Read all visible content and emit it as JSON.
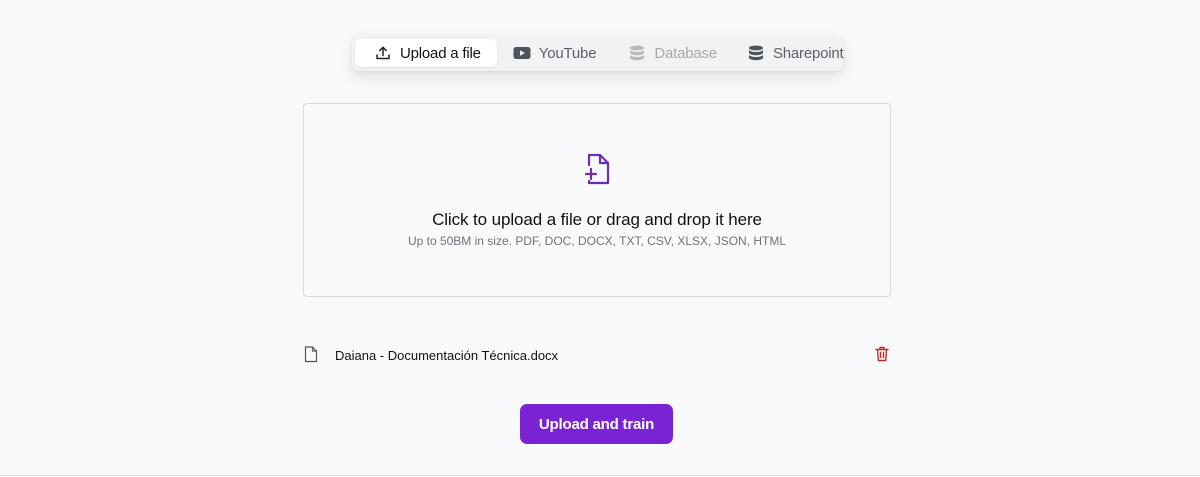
{
  "tabs": [
    {
      "label": "Upload a file",
      "icon": "upload-icon",
      "state": "active"
    },
    {
      "label": "YouTube",
      "icon": "youtube-icon",
      "state": "normal"
    },
    {
      "label": "Database",
      "icon": "database-icon",
      "state": "disabled"
    },
    {
      "label": "Sharepoint",
      "icon": "database-icon",
      "state": "normal"
    }
  ],
  "dropzone": {
    "icon": "file-plus-icon",
    "title": "Click to upload a file or drag and drop it here",
    "subtitle": "Up to 50BM in size. PDF, DOC, DOCX, TXT, CSV, XLSX, JSON, HTML"
  },
  "files": [
    {
      "name": "Daiana - Documentación Técnica.docx",
      "icon": "file-icon",
      "action_icon": "trash-icon"
    }
  ],
  "actions": {
    "upload_label": "Upload and train"
  },
  "colors": {
    "accent": "#7a23d4",
    "danger": "#c62828",
    "icon_purple": "#6b2fb3"
  }
}
